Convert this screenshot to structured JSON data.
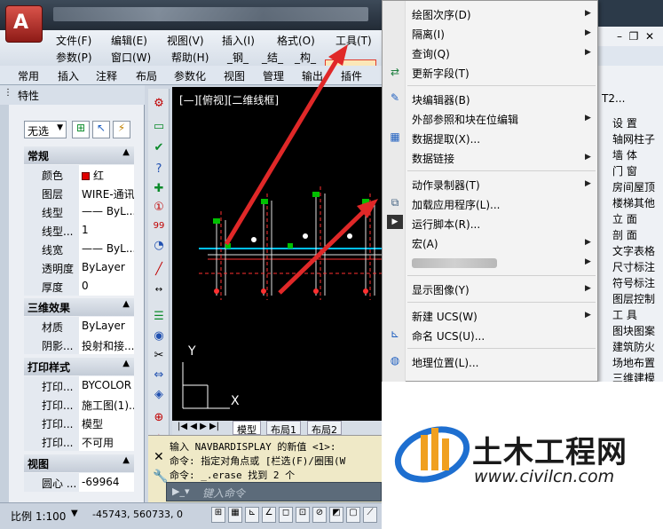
{
  "menubar": {
    "row1": [
      "文件(F)",
      "编辑(E)",
      "视图(V)",
      "插入(I)",
      "格式(O)",
      "工具(T)"
    ],
    "row2": [
      "参数(P)",
      "窗口(W)",
      "帮助(H)",
      "_钢_",
      "_结_",
      "_构_"
    ]
  },
  "ribbon_tabs": [
    "常用",
    "插入",
    "注释",
    "布局",
    "参数化",
    "视图",
    "管理",
    "输出",
    "插件"
  ],
  "properties": {
    "title": "特性",
    "selector": "无选",
    "sections": {
      "general": "常规",
      "3d": "三维效果",
      "print": "打印样式",
      "view": "视图"
    },
    "general_rows": [
      {
        "label": "颜色",
        "value": "红"
      },
      {
        "label": "图层",
        "value": "WIRE-通讯"
      },
      {
        "label": "线型",
        "value": "—— ByL..."
      },
      {
        "label": "线型...",
        "value": "1"
      },
      {
        "label": "线宽",
        "value": "—— ByL..."
      },
      {
        "label": "透明度",
        "value": "ByLayer"
      },
      {
        "label": "厚度",
        "value": "0"
      }
    ],
    "3d_rows": [
      {
        "label": "材质",
        "value": "ByLayer"
      },
      {
        "label": "阴影...",
        "value": "投射和接..."
      }
    ],
    "print_rows": [
      {
        "label": "打印...",
        "value": "BYCOLOR"
      },
      {
        "label": "打印...",
        "value": "施工图(1)..."
      },
      {
        "label": "打印...",
        "value": "模型"
      },
      {
        "label": "打印...",
        "value": "不可用"
      }
    ],
    "view_rows": [
      {
        "label": "圆心 ...",
        "value": "-69964"
      }
    ]
  },
  "canvas": {
    "viewport_label": "[—][俯视][二维线框]",
    "axis_y": "Y",
    "axis_x": "X"
  },
  "layout_tabs": [
    "模型",
    "布局1",
    "布局2"
  ],
  "command": {
    "lines": [
      "输入 NAVBARDISPLAY 的新值 <1>:",
      "命令: 指定对角点或 [栏选(F)/圈围(W",
      "命令: _.erase 找到 2 个"
    ],
    "placeholder": "键入命令"
  },
  "status": {
    "scale": "比例 1:100",
    "coords": "-45743, 560733, 0"
  },
  "tools_menu": {
    "items": [
      {
        "label": "绘图次序(D)",
        "submenu": true
      },
      {
        "label": "隔离(I)",
        "submenu": true
      },
      {
        "label": "查询(Q)",
        "submenu": true
      },
      {
        "label": "更新字段(T)",
        "submenu": false,
        "icon": "update-fields-icon"
      },
      {
        "label": "块编辑器(B)",
        "submenu": false,
        "icon": "block-editor-icon"
      },
      {
        "label": "外部参照和块在位编辑",
        "submenu": true
      },
      {
        "label": "数据提取(X)...",
        "submenu": false,
        "icon": "data-extraction-icon"
      },
      {
        "label": "数据链接",
        "submenu": true
      },
      {
        "label": "动作录制器(T)",
        "submenu": true
      },
      {
        "label": "加载应用程序(L)...",
        "submenu": false,
        "icon": "load-application-icon"
      },
      {
        "label": "运行脚本(R)...",
        "submenu": false,
        "icon": "run-script-icon"
      },
      {
        "label": "宏(A)",
        "submenu": true
      },
      {
        "label": "显示图像(Y)",
        "submenu": true
      },
      {
        "label": "新建 UCS(W)",
        "submenu": true
      },
      {
        "label": "命名 UCS(U)...",
        "submenu": false,
        "icon": "named-ucs-icon"
      },
      {
        "label": "地理位置(L)...",
        "submenu": false,
        "icon": "geolocation-icon"
      }
    ]
  },
  "right_panel": {
    "header": "T2...",
    "items": [
      "设 置",
      "轴网柱子",
      "墙 体",
      "门 窗",
      "房间屋顶",
      "楼梯其他",
      "立 面",
      "剖 面",
      "文字表格",
      "尺寸标注",
      "符号标注",
      "图层控制",
      "工 具",
      "图块图案",
      "建筑防火",
      "场地布置",
      "三维建模"
    ]
  },
  "watermark": {
    "title": "土木工程网",
    "url": "www.civilcn.com"
  }
}
